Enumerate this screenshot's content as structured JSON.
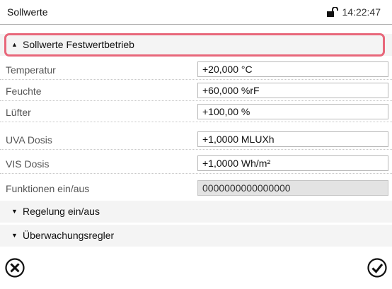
{
  "header": {
    "title": "Sollwerte",
    "time": "14:22:47",
    "lock_icon": "lock-open-icon"
  },
  "sections": {
    "fixed_mode": "Sollwerte Festwertbetrieb",
    "control": "Regelung ein/aus",
    "monitoring": "Überwachungsregler"
  },
  "rows": [
    {
      "label": "Temperatur",
      "value": "+20,000 °C"
    },
    {
      "label": "Feuchte",
      "value": "+60,000 %rF"
    },
    {
      "label": "Lüfter",
      "value": "+100,00 %"
    },
    {
      "label": "UVA Dosis",
      "value": "+1,0000 MLUXh"
    },
    {
      "label": "VIS Dosis",
      "value": "+1,0000 Wh/m²"
    },
    {
      "label": "Funktionen ein/aus",
      "value": "0000000000000000"
    }
  ],
  "footer": {
    "cancel_icon": "cancel-icon",
    "confirm_icon": "confirm-icon"
  },
  "colors": {
    "highlight": "#e8677a",
    "readonly_field": "#e3e3e3"
  }
}
